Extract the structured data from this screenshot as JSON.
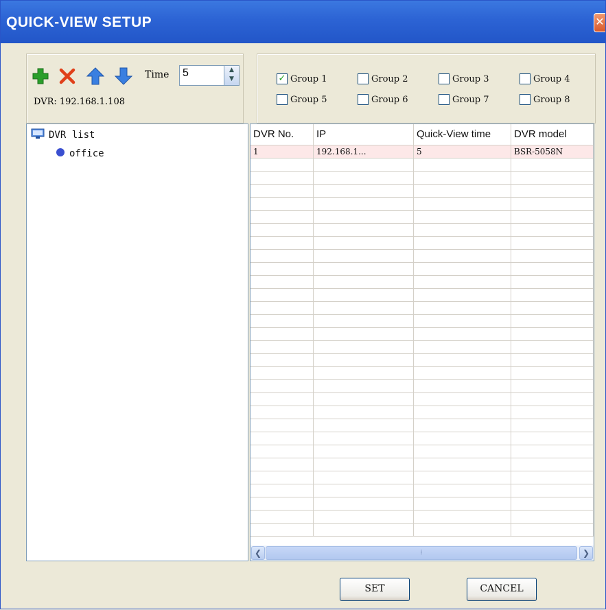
{
  "window": {
    "title": "QUICK-VIEW SETUP",
    "close_glyph": "✕"
  },
  "toolbar": {
    "icons": [
      "add-icon",
      "delete-icon",
      "move-up-icon",
      "move-down-icon"
    ],
    "time_label": "Time",
    "time_value": "5",
    "dvr_ip_text": "DVR: 192.168.1.108"
  },
  "groups": [
    {
      "label": "Group 1",
      "checked": true
    },
    {
      "label": "Group 2",
      "checked": false
    },
    {
      "label": "Group 3",
      "checked": false
    },
    {
      "label": "Group 4",
      "checked": false
    },
    {
      "label": "Group 5",
      "checked": false
    },
    {
      "label": "Group 6",
      "checked": false
    },
    {
      "label": "Group 7",
      "checked": false
    },
    {
      "label": "Group 8",
      "checked": false
    }
  ],
  "tree": {
    "root_label": "DVR list",
    "child_label": "office"
  },
  "table": {
    "columns": [
      "DVR No.",
      "IP",
      "Quick-View time",
      "DVR model"
    ],
    "rows": [
      [
        "1",
        "192.168.1...",
        "5",
        "BSR-5058N"
      ]
    ]
  },
  "buttons": {
    "set": "SET",
    "cancel": "CANCEL"
  },
  "colors": {
    "titlebar": "#2c63d4",
    "selected_row": "#fde8e8",
    "add_icon": "#2a9e2a",
    "delete_icon": "#e0401a",
    "arrow_icon": "#3a7fe0"
  }
}
